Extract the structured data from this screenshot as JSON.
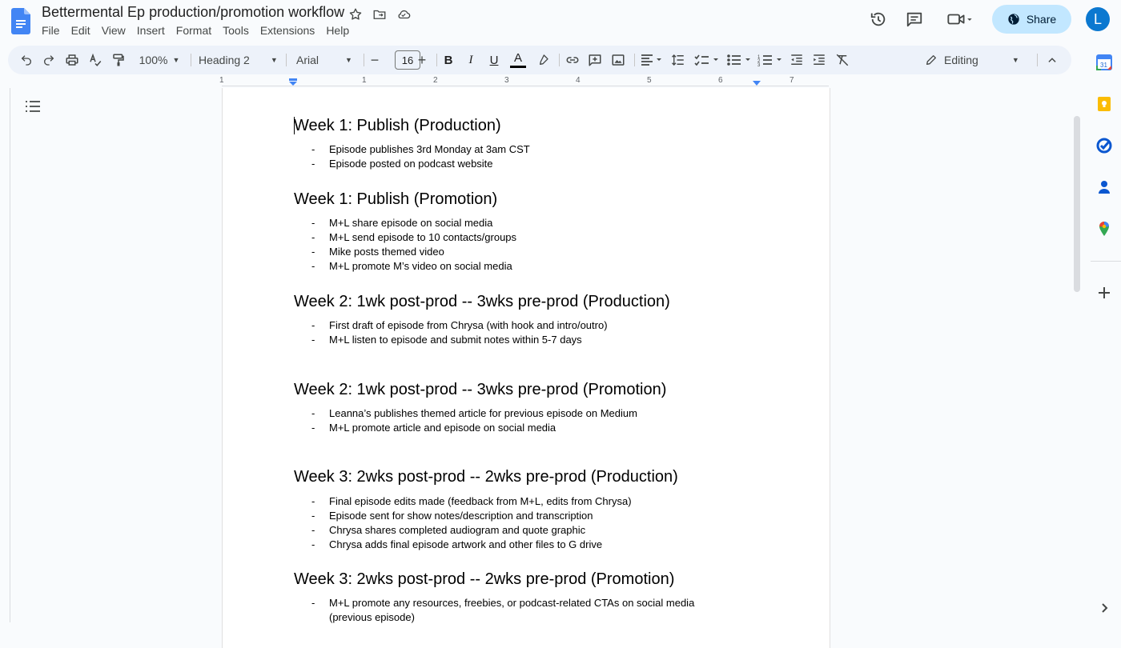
{
  "app": {
    "doc_title": "Bettermental Ep production/promotion workflow",
    "menu": [
      "File",
      "Edit",
      "View",
      "Insert",
      "Format",
      "Tools",
      "Extensions",
      "Help"
    ],
    "share_label": "Share",
    "avatar_letter": "L",
    "accent": "#0b57d0",
    "share_bg": "#c2e7ff"
  },
  "toolbar": {
    "zoom": "100%",
    "style": "Heading 2",
    "font": "Arial",
    "font_size": "16",
    "mode": "Editing",
    "minus": "−",
    "plus": "+",
    "bold": "B",
    "italic": "I",
    "underline": "U",
    "text_color": "A"
  },
  "ruler": {
    "numbers": [
      "1",
      "1",
      "2",
      "3",
      "4",
      "5",
      "6",
      "7"
    ]
  },
  "document": {
    "sections": [
      {
        "heading": "Week 1: Publish (Production)",
        "items": [
          "Episode publishes 3rd Monday at 3am CST",
          "Episode posted on podcast website"
        ]
      },
      {
        "heading": "Week 1: Publish (Promotion)",
        "items": [
          "M+L share episode on social media",
          "M+L send episode to 10 contacts/groups",
          "Mike posts themed video",
          "M+L promote M’s video on social media"
        ]
      },
      {
        "heading": "Week 2: 1wk post-prod -- 3wks pre-prod (Production)",
        "items": [
          "First draft of episode from Chrysa (with hook and intro/outro)",
          "M+L listen to episode and submit notes within 5-7 days"
        ]
      },
      {
        "heading": "Week 2: 1wk post-prod -- 3wks pre-prod (Promotion)",
        "items": [
          "Leanna’s publishes themed article for previous episode on Medium",
          "M+L promote article and episode on social media"
        ]
      },
      {
        "heading": "Week 3: 2wks post-prod -- 2wks pre-prod (Production)",
        "items": [
          "Final episode edits made (feedback from M+L, edits from Chrysa)",
          "Episode sent for show notes/description and transcription",
          "Chrysa shares completed audiogram and quote graphic",
          "Chrysa adds final episode artwork and other files to G drive"
        ]
      },
      {
        "heading": "Week 3: 2wks post-prod -- 2wks pre-prod (Promotion)",
        "items": [
          "M+L promote any resources, freebies, or podcast-related CTAs on social media",
          "(previous episode)"
        ]
      }
    ],
    "bullet": "-"
  }
}
